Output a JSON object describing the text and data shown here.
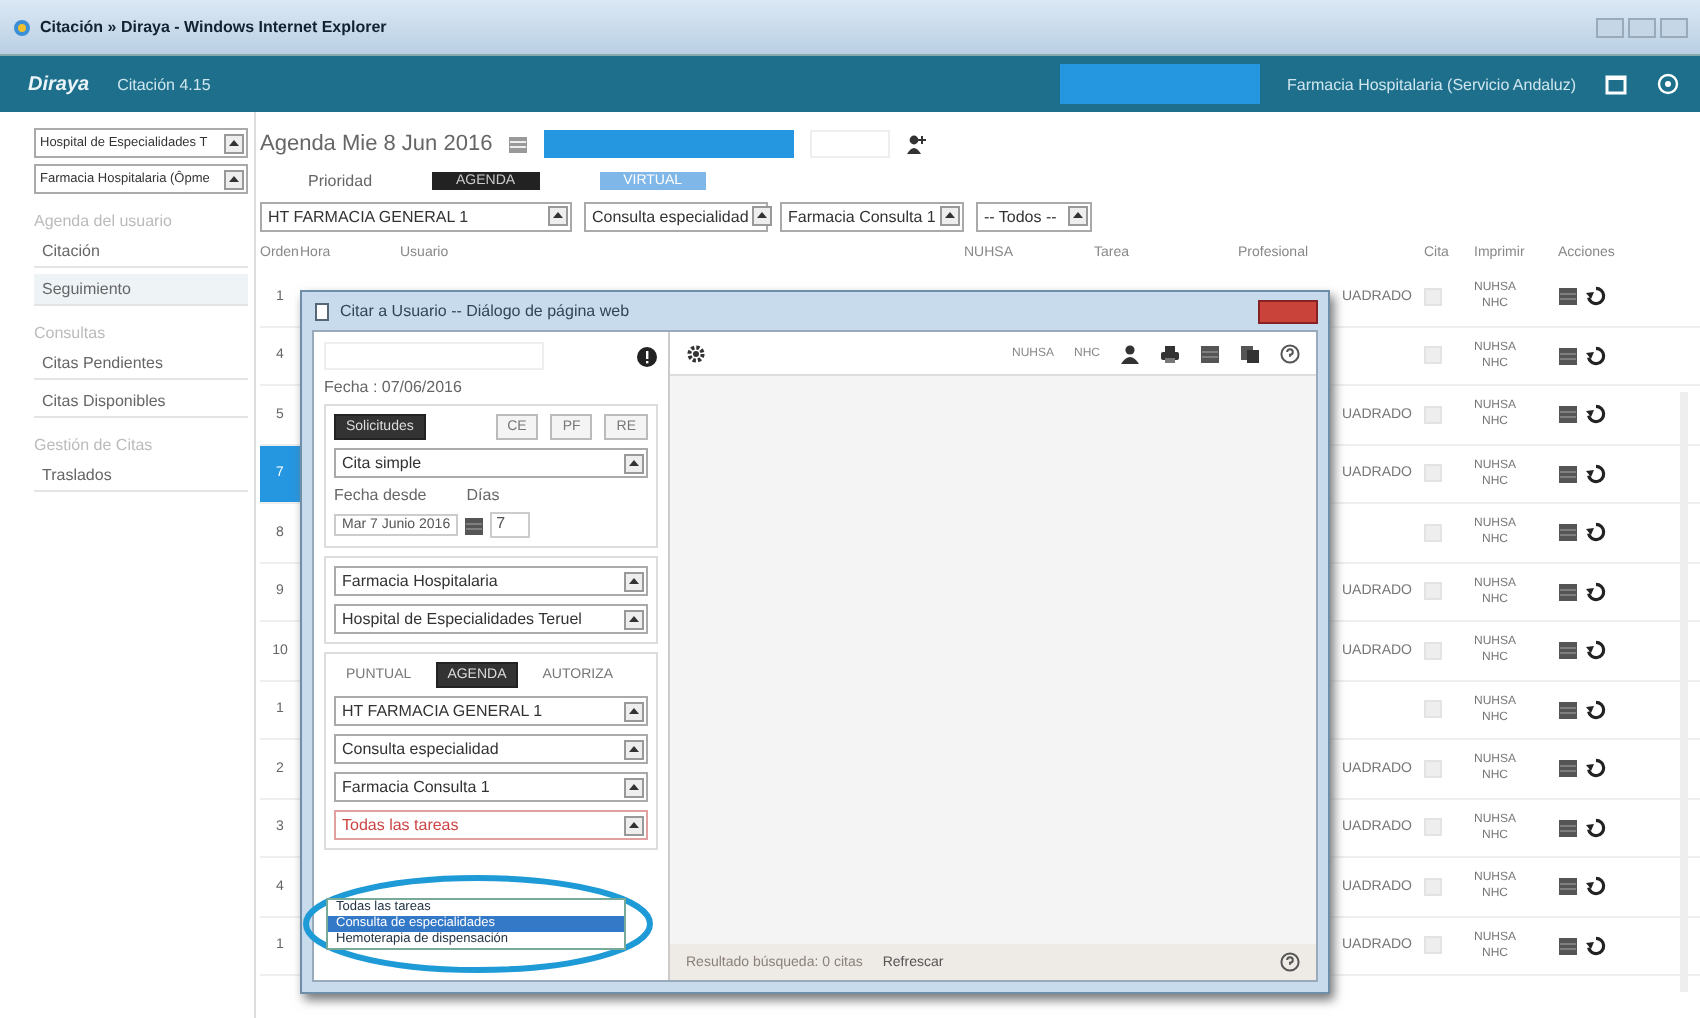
{
  "browser": {
    "title": "Citación » Diraya - Windows Internet Explorer"
  },
  "app_header": {
    "logo": "Diraya",
    "module": "Citación 4.15",
    "user": "Farmacia Hospitalaria (Servicio Andaluz)"
  },
  "sidebar": {
    "selects": [
      "Hospital de Especialidades T",
      "Farmacia Hospitalaria (Ôpme"
    ],
    "sections": [
      {
        "heading": "Agenda del usuario",
        "items": [
          {
            "label": "Citación",
            "selected": false
          },
          {
            "label": "Seguimiento",
            "selected": true
          }
        ]
      },
      {
        "heading": "Consultas",
        "items": [
          {
            "label": "Citas Pendientes",
            "selected": false
          },
          {
            "label": "Citas Disponibles",
            "selected": false
          }
        ]
      },
      {
        "heading": "Gestión de Citas",
        "items": [
          {
            "label": "Traslados",
            "selected": false
          }
        ]
      }
    ]
  },
  "agenda": {
    "title": "Agenda  Mie 8 Jun 2016",
    "tabs_label": "Prioridad",
    "tabs": [
      {
        "label": "AGENDA",
        "selected": true
      },
      {
        "label": "VIRTUAL",
        "selected": false
      }
    ],
    "filters": [
      "HT FARMACIA GENERAL 1",
      "Consulta especialidad",
      "Farmacia Consulta 1",
      "-- Todos --"
    ]
  },
  "table": {
    "columns": [
      "Orden",
      "Hora",
      "Usuario",
      "NUHSA",
      "Tarea",
      "Profesional",
      "Cita",
      "Imprimir",
      "Acciones"
    ],
    "rows": [
      {
        "order": "1",
        "professional": "UADRADO",
        "checked": false,
        "print": [
          "NUHSA",
          "NHC"
        ],
        "selected": false
      },
      {
        "order": "4",
        "professional": "",
        "checked": false,
        "print": [
          "NUHSA",
          "NHC"
        ],
        "selected": false
      },
      {
        "order": "5",
        "professional": "UADRADO",
        "checked": false,
        "print": [
          "NUHSA",
          "NHC"
        ],
        "selected": false
      },
      {
        "order": "7",
        "professional": "UADRADO",
        "checked": false,
        "print": [
          "NUHSA",
          "NHC"
        ],
        "selected": true
      },
      {
        "order": "8",
        "professional": "",
        "checked": false,
        "print": [
          "NUHSA",
          "NHC"
        ],
        "selected": false
      },
      {
        "order": "9",
        "professional": "UADRADO",
        "checked": false,
        "print": [
          "NUHSA",
          "NHC"
        ],
        "selected": false
      },
      {
        "order": "10",
        "professional": "UADRADO",
        "checked": false,
        "print": [
          "NUHSA",
          "NHC"
        ],
        "selected": false
      },
      {
        "order": "1",
        "professional": "",
        "checked": false,
        "print": [
          "NUHSA",
          "NHC"
        ],
        "selected": false
      },
      {
        "order": "2",
        "professional": "UADRADO",
        "checked": false,
        "print": [
          "NUHSA",
          "NHC"
        ],
        "selected": false
      },
      {
        "order": "3",
        "professional": "UADRADO",
        "checked": false,
        "print": [
          "NUHSA",
          "NHC"
        ],
        "selected": false
      },
      {
        "order": "4",
        "professional": "UADRADO",
        "checked": false,
        "print": [
          "NUHSA",
          "NHC"
        ],
        "selected": false
      },
      {
        "order": "1",
        "professional": "UADRADO",
        "checked": false,
        "print": [
          "NUHSA",
          "NHC"
        ],
        "selected": false
      }
    ]
  },
  "dialog": {
    "title": "Citar a Usuario -- Diálogo de página web",
    "date": "Fecha :  07/06/2016",
    "mode_tabs": [
      {
        "label": "Solicitudes",
        "selected": true
      },
      {
        "label": "CE",
        "selected": false
      },
      {
        "label": "PF",
        "selected": false
      },
      {
        "label": "RE",
        "selected": false
      }
    ],
    "cita_type": "Cita simple",
    "date_label": "Fecha desde",
    "days_label": "Días",
    "date_value": "Mar 7 Junio 2016",
    "days_value": "7",
    "center_selects": [
      "Farmacia Hospitalaria",
      "Hospital de Especialidades Teruel"
    ],
    "priority_tabs": [
      {
        "label": "PUNTUAL",
        "selected": false
      },
      {
        "label": "AGENDA",
        "selected": true
      },
      {
        "label": "AUTORIZA",
        "selected": false
      }
    ],
    "selects": [
      {
        "value": "HT FARMACIA GENERAL 1",
        "warning": false
      },
      {
        "value": "Consulta especialidad",
        "warning": false
      },
      {
        "value": "Farmacia Consulta 1",
        "warning": false
      },
      {
        "value": "Todas las tareas",
        "warning": true
      }
    ],
    "dropdown": [
      {
        "label": "Todas las tareas",
        "selected": false
      },
      {
        "label": "Consulta de especialidades",
        "selected": true
      },
      {
        "label": "Hemoterapia de dispensación",
        "selected": false
      }
    ],
    "toolbar_labels": [
      "NUHSA",
      "NHC"
    ],
    "status": "Resultado búsqueda: 0 citas",
    "refresh": "Refrescar"
  }
}
